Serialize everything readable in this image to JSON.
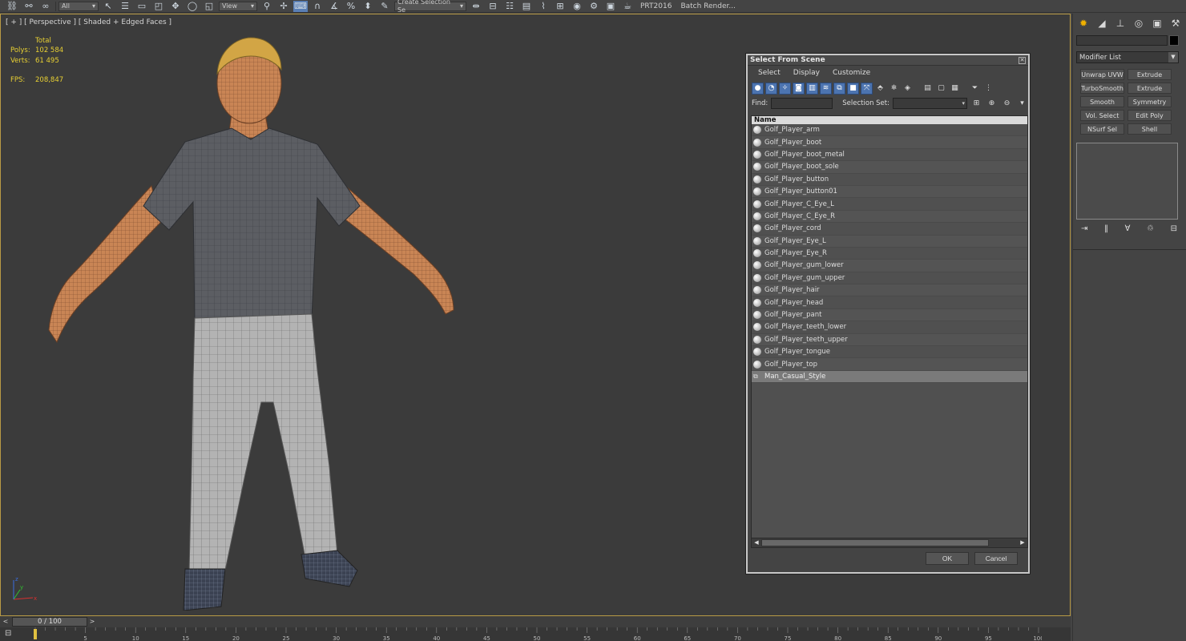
{
  "toolbar": {
    "filter_value": "All",
    "view_value": "View",
    "selection_set_placeholder": "Create Selection Se",
    "prt_label": "PRT2016",
    "batch_render_label": "Batch Render..."
  },
  "viewport": {
    "label": "[ + ] [ Perspective ] [ Shaded + Edged Faces ]",
    "stats": {
      "header": "Total",
      "polys_label": "Polys:",
      "polys_value": "102 584",
      "verts_label": "Verts:",
      "verts_value": "61 495",
      "fps_label": "FPS:",
      "fps_value": "208,847"
    },
    "axis": {
      "x": "x",
      "y": "y",
      "z": "z"
    }
  },
  "dialog": {
    "title": "Select From Scene",
    "close": "✕",
    "menu": [
      "Select",
      "Display",
      "Customize"
    ],
    "find_label": "Find:",
    "selection_set_label": "Selection Set:",
    "column_name": "Name",
    "items": [
      "Golf_Player_arm",
      "Golf_Player_boot",
      "Golf_Player_boot_metal",
      "Golf_Player_boot_sole",
      "Golf_Player_button",
      "Golf_Player_button01",
      "Golf_Player_C_Eye_L",
      "Golf_Player_C_Eye_R",
      "Golf_Player_cord",
      "Golf_Player_Eye_L",
      "Golf_Player_Eye_R",
      "Golf_Player_gum_lower",
      "Golf_Player_gum_upper",
      "Golf_Player_hair",
      "Golf_Player_head",
      "Golf_Player_pant",
      "Golf_Player_teeth_lower",
      "Golf_Player_teeth_upper",
      "Golf_Player_tongue",
      "Golf_Player_top"
    ],
    "group_item": "Man_Casual_Style",
    "ok_label": "OK",
    "cancel_label": "Cancel"
  },
  "command_panel": {
    "modifier_list": "Modifier List",
    "modifiers": [
      "Unwrap UVW",
      "Extrude",
      "TurboSmooth",
      "Extrude",
      "Smooth",
      "Symmetry",
      "Vol. Select",
      "Edit Poly",
      "NSurf Sel",
      "Shell"
    ]
  },
  "timeline": {
    "slider": "0 / 100",
    "ticks": [
      "5",
      "10",
      "15",
      "20",
      "25",
      "30",
      "35",
      "40",
      "45",
      "50",
      "55",
      "60",
      "65",
      "70",
      "75",
      "80",
      "85",
      "90",
      "95",
      "100"
    ]
  },
  "colors": {
    "viewport_border": "#b89a45",
    "stats_text": "#e8d033",
    "skin": "#c98555",
    "shirt": "#5c5e63",
    "pants": "#b3b3b3",
    "shoes": "#3b4252"
  }
}
